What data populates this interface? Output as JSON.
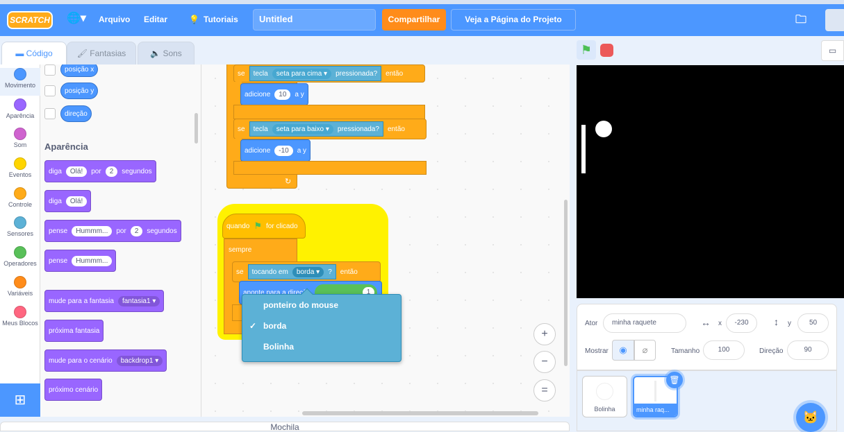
{
  "menubar": {
    "logo": "SCRATCH",
    "file": "Arquivo",
    "edit": "Editar",
    "tutorials": "Tutoriais",
    "project_title": "Untitled",
    "share": "Compartilhar",
    "see_project": "Veja a Página do Projeto"
  },
  "tabs": {
    "code": "Código",
    "costumes": "Fantasias",
    "sounds": "Sons"
  },
  "categories": [
    {
      "label": "Movimento",
      "color": "#4c97ff"
    },
    {
      "label": "Aparência",
      "color": "#9966ff"
    },
    {
      "label": "Som",
      "color": "#cf63cf"
    },
    {
      "label": "Eventos",
      "color": "#ffd500"
    },
    {
      "label": "Controle",
      "color": "#ffab19"
    },
    {
      "label": "Sensores",
      "color": "#5cb1d6"
    },
    {
      "label": "Operadores",
      "color": "#59c059"
    },
    {
      "label": "Variáveis",
      "color": "#ff8c1a"
    },
    {
      "label": "Meus Blocos",
      "color": "#ff6680"
    }
  ],
  "palette": {
    "motion_reporters": [
      "posição x",
      "posição y",
      "direção"
    ],
    "looks_heading": "Aparência",
    "say_secs": {
      "a": "diga",
      "v": "Olá!",
      "b": "por",
      "n": "2",
      "c": "segundos"
    },
    "say": {
      "a": "diga",
      "v": "Olá!"
    },
    "think_secs": {
      "a": "pense",
      "v": "Hummm...",
      "b": "por",
      "n": "2",
      "c": "segundos"
    },
    "think": {
      "a": "pense",
      "v": "Hummm..."
    },
    "switch_costume": {
      "a": "mude para a fantasia",
      "v": "fantasia1"
    },
    "next_costume": "próxima fantasia",
    "switch_backdrop": {
      "a": "mude para o cenário",
      "v": "backdrop1"
    },
    "next_backdrop": "próximo cenário"
  },
  "scripts": {
    "if1": {
      "se": "se",
      "key": "tecla",
      "keyval": "seta para cima",
      "pressed": "pressionada?",
      "then": "então",
      "add": "adicione",
      "n": "10",
      "ay": "a y"
    },
    "if2": {
      "se": "se",
      "key": "tecla",
      "keyval": "seta para baixo",
      "pressed": "pressionada?",
      "then": "então",
      "add": "adicione",
      "n": "-10",
      "ay": "a y"
    },
    "hat": {
      "a": "quando",
      "b": "for clicado"
    },
    "forever": "sempre",
    "if3": {
      "se": "se",
      "touch": "tocando em",
      "val": "borda",
      "q": "?",
      "then": "então"
    },
    "point": {
      "a": "aponte para a direção",
      "v": "1"
    }
  },
  "dropdown": {
    "items": [
      "ponteiro do mouse",
      "borda",
      "Bolinha"
    ],
    "selected": "borda",
    "check": "✓"
  },
  "zoom": {
    "in": "+",
    "out": "−",
    "reset": "="
  },
  "mochila": "Mochila",
  "sprite": {
    "label_sprite": "Ator",
    "name": "minha raquete",
    "x_label": "x",
    "x": "-230",
    "y_label": "y",
    "y": "50",
    "show_label": "Mostrar",
    "size_label": "Tamanho",
    "size": "100",
    "dir_label": "Direção",
    "dir": "90"
  },
  "sprites": [
    {
      "name": "Bolinha"
    },
    {
      "name": "minha raq..."
    }
  ]
}
